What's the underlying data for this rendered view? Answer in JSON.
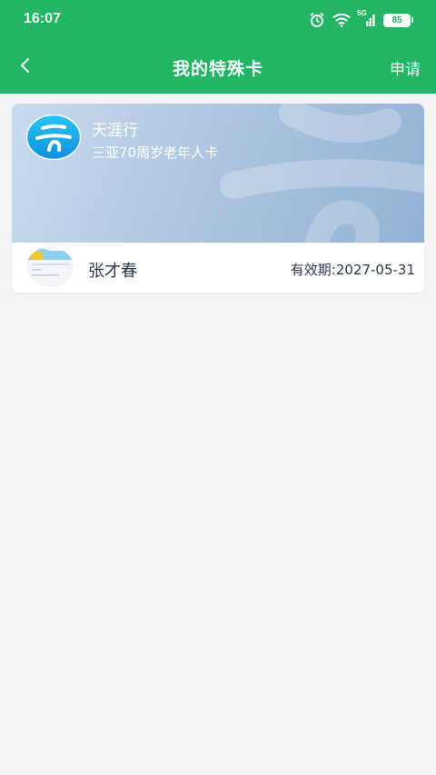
{
  "status_bar": {
    "time": "16:07",
    "alarm_icon": "alarm-clock-icon",
    "wifi_icon": "wifi-icon",
    "network_label": "5G",
    "signal_icon": "signal-bars-icon",
    "battery_level": "85"
  },
  "nav": {
    "back_icon": "chevron-left-icon",
    "title": "我的特殊卡",
    "action_label": "申请"
  },
  "card": {
    "brand": "天涯行",
    "type": "三亚70周岁老年人卡",
    "holder_name": "张才春",
    "validity": "有效期:2027-05-31"
  },
  "colors": {
    "header_green": "#22b563",
    "page_bg": "#f4f4f4",
    "banner_blue": "#a9c2de",
    "text_dark": "#2a3a52"
  }
}
